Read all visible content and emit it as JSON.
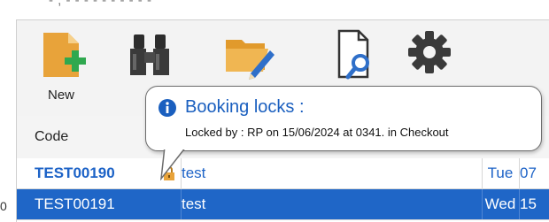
{
  "top_strip": {
    "clipped_text": "- , - - - - - - - - - -"
  },
  "left_edge": {
    "digit": "0"
  },
  "toolbar": {
    "buttons": [
      {
        "label": "New",
        "icon": "new-document-icon"
      },
      {
        "label": "",
        "icon": "binoculars-icon"
      },
      {
        "label": "",
        "icon": "folder-edit-icon"
      },
      {
        "label": "",
        "icon": "document-search-icon"
      },
      {
        "label": "",
        "icon": "gear-icon"
      }
    ]
  },
  "grid": {
    "headers": {
      "code": "Code"
    },
    "rows": [
      {
        "code": "TEST00190",
        "description": "test",
        "day": "Tue",
        "date": "07",
        "locked": true
      },
      {
        "code": "TEST00191",
        "description": "test",
        "day": "Wed",
        "date": "15",
        "selected": true
      }
    ]
  },
  "tooltip": {
    "title": "Booking locks :",
    "body": "Locked by : RP on 15/06/2024 at 0341.  in  Checkout"
  },
  "colors": {
    "accent": "#1f66c7",
    "link_text": "#1d63c7",
    "toolbar_bg": "#f3f3f3",
    "icon_orange": "#e8a33a",
    "icon_green": "#2fa84f"
  }
}
